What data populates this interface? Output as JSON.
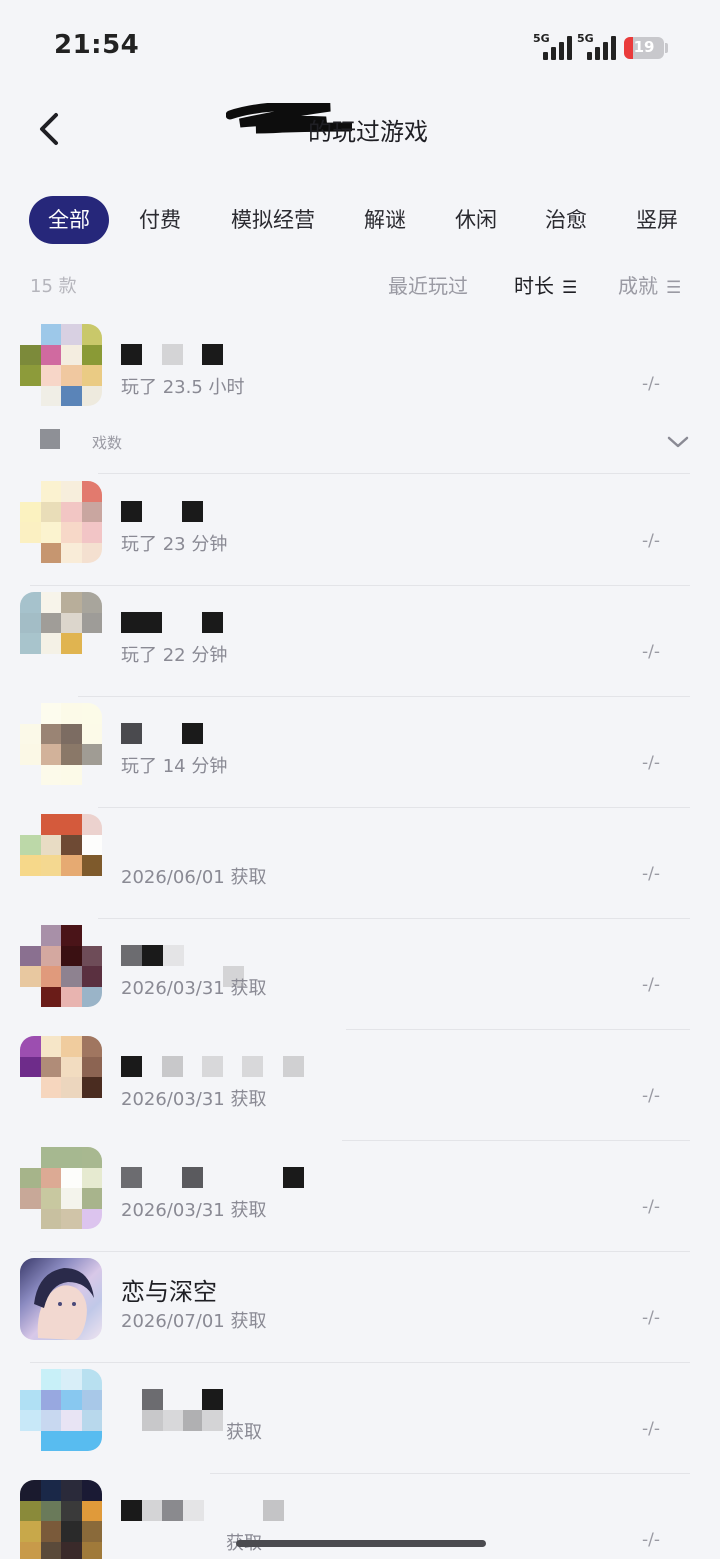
{
  "status_bar": {
    "time": "21:54",
    "signal_1": "5G",
    "signal_2": "5G",
    "battery": "19"
  },
  "header": {
    "title": "的玩过游戏"
  },
  "tabs": [
    {
      "label": "全部",
      "active": true
    },
    {
      "label": "付费"
    },
    {
      "label": "模拟经营"
    },
    {
      "label": "解谜"
    },
    {
      "label": "休闲"
    },
    {
      "label": "治愈"
    },
    {
      "label": "竖屏"
    }
  ],
  "sort": {
    "count_label": "15 款",
    "options": [
      {
        "label": "最近玩过",
        "active": false
      },
      {
        "label": "时长",
        "active": true
      },
      {
        "label": "成就",
        "active": false
      }
    ]
  },
  "expand": {
    "label": "戏数"
  },
  "games": [
    {
      "meta": "玩了 23.5 小时",
      "score": "-/-"
    },
    {
      "meta": "玩了 23 分钟",
      "score": "-/-"
    },
    {
      "meta": "玩了 22 分钟",
      "score": "-/-"
    },
    {
      "meta": "玩了 14 分钟",
      "score": "-/-"
    },
    {
      "meta": "2026/06/01 获取",
      "score": "-/-"
    },
    {
      "meta": "2026/03/31 获取",
      "score": "-/-"
    },
    {
      "meta": "2026/03/31 获取",
      "score": "-/-"
    },
    {
      "meta": "2026/03/31 获取",
      "score": "-/-"
    },
    {
      "name": "恋与深空",
      "meta": "2026/07/01 获取",
      "score": "-/-"
    },
    {
      "meta": "获取",
      "score": "-/-"
    },
    {
      "meta": "获取",
      "score": "-/-"
    }
  ]
}
